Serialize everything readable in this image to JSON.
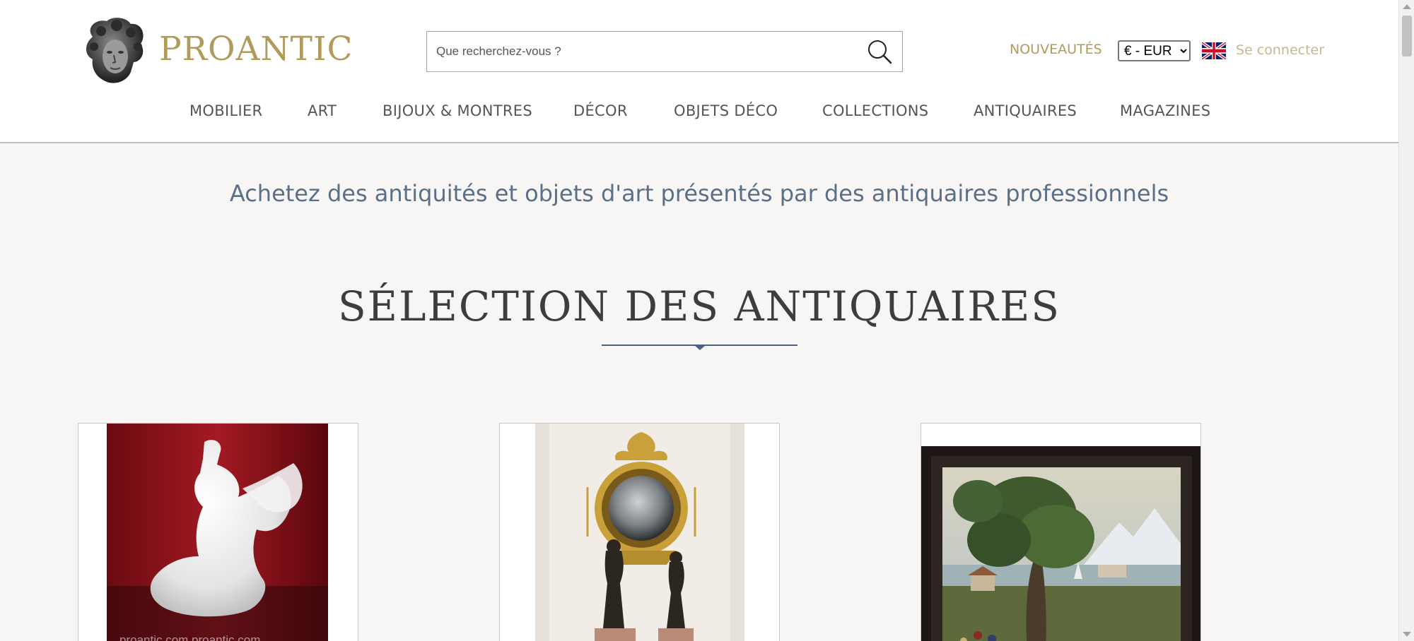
{
  "header": {
    "logo_text": "PROANTIC",
    "search_placeholder": "Que recherchez-vous ?",
    "nouveautes": "NOUVEAUTÉS",
    "currency_selected": "€ - EUR",
    "login": "Se connecter"
  },
  "nav": {
    "items": [
      {
        "label": "MOBILIER"
      },
      {
        "label": "ART"
      },
      {
        "label": "BIJOUX & MONTRES"
      },
      {
        "label": "DÉCOR"
      },
      {
        "label": "OBJETS DÉCO"
      },
      {
        "label": "COLLECTIONS"
      },
      {
        "label": "ANTIQUAIRES"
      },
      {
        "label": "MAGAZINES"
      }
    ]
  },
  "main": {
    "tagline": "Achetez des antiquités et objets d'art présentés par des antiquaires professionnels",
    "section_title": "SÉLECTION DES ANTIQUAIRES",
    "cards": [
      {
        "image": "marble-sculpture",
        "watermark": "proantic.com   proantic.com"
      },
      {
        "image": "gilt-convex-mirror-and-bronze-figures"
      },
      {
        "image": "framed-landscape-painting"
      }
    ]
  },
  "colors": {
    "gold": "#b19a5c",
    "login_gold": "#c9b68d",
    "tagline_blue": "#5a6f88",
    "divider_blue": "#4a6382",
    "background": "#f7f6f4"
  },
  "icons": {
    "search": "search-icon",
    "flag": "uk-flag-icon",
    "logo": "statue-head-logo-icon"
  }
}
